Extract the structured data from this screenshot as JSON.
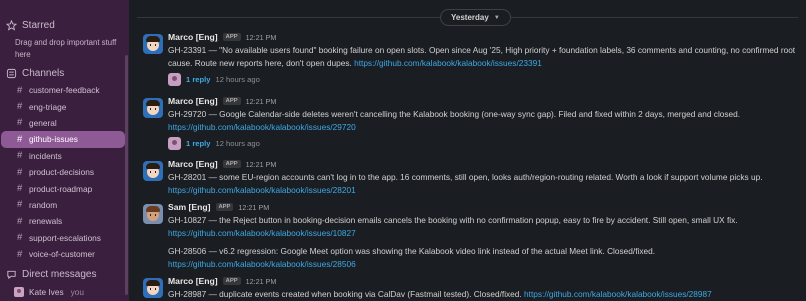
{
  "sidebar": {
    "starred_label": "Starred",
    "starred_hint": "Drag and drop important stuff here",
    "channels_label": "Channels",
    "channels": [
      {
        "name": "customer-feedback",
        "active": false
      },
      {
        "name": "eng-triage",
        "active": false
      },
      {
        "name": "general",
        "active": false
      },
      {
        "name": "github-issues",
        "active": true
      },
      {
        "name": "incidents",
        "active": false
      },
      {
        "name": "product-decisions",
        "active": false
      },
      {
        "name": "product-roadmap",
        "active": false
      },
      {
        "name": "random",
        "active": false
      },
      {
        "name": "renewals",
        "active": false
      },
      {
        "name": "support-escalations",
        "active": false
      },
      {
        "name": "voice-of-customer",
        "active": false
      }
    ],
    "dm_label": "Direct messages",
    "dm_user": "Kate Ives",
    "dm_you": "you"
  },
  "date_divider": "Yesterday",
  "messages": [
    {
      "author": "Marco [Eng]",
      "badge": "APP",
      "time": "12:21 PM",
      "text": "GH-23391 — \"No available users found\" booking failure on open slots. Open since Aug '25, High priority + foundation labels, 36 comments and counting, no confirmed root cause. Route new reports here, don't open dupes.",
      "link": "https://github.com/kalabook/kalabook/issues/23391",
      "replies": "1 reply",
      "reply_ago": "12 hours ago"
    },
    {
      "author": "Marco [Eng]",
      "badge": "APP",
      "time": "12:21 PM",
      "text": "GH-29720 — Google Calendar-side deletes weren't cancelling the Kalabook booking (one-way sync gap). Filed and fixed within 2 days, merged and closed.",
      "link": "https://github.com/kalabook/kalabook/issues/29720",
      "replies": "1 reply",
      "reply_ago": "12 hours ago"
    },
    {
      "author": "Marco [Eng]",
      "badge": "APP",
      "time": "12:21 PM",
      "text": "GH-28201 — some EU-region accounts can't log in to the app. 16 comments, still open, looks auth/region-routing related. Worth a look if support volume picks up.",
      "link": "https://github.com/kalabook/kalabook/issues/28201"
    },
    {
      "author": "Sam [Eng]",
      "badge": "APP",
      "time": "12:21 PM",
      "text": "GH-10827 — the Reject button in booking-decision emails cancels the booking with no confirmation popup, easy to fire by accident. Still open, small UX fix.",
      "link": "https://github.com/kalabook/kalabook/issues/10827",
      "text2": "GH-28506 — v6.2 regression: Google Meet option was showing the Kalabook video link instead of the actual Meet link. Closed/fixed.",
      "link2": "https://github.com/kalabook/kalabook/issues/28506"
    },
    {
      "author": "Marco [Eng]",
      "badge": "APP",
      "time": "12:21 PM",
      "text": "GH-28987 — duplicate events created when booking via CalDav (Fastmail tested). Closed/fixed.",
      "link": "https://github.com/kalabook/kalabook/issues/28987"
    }
  ]
}
